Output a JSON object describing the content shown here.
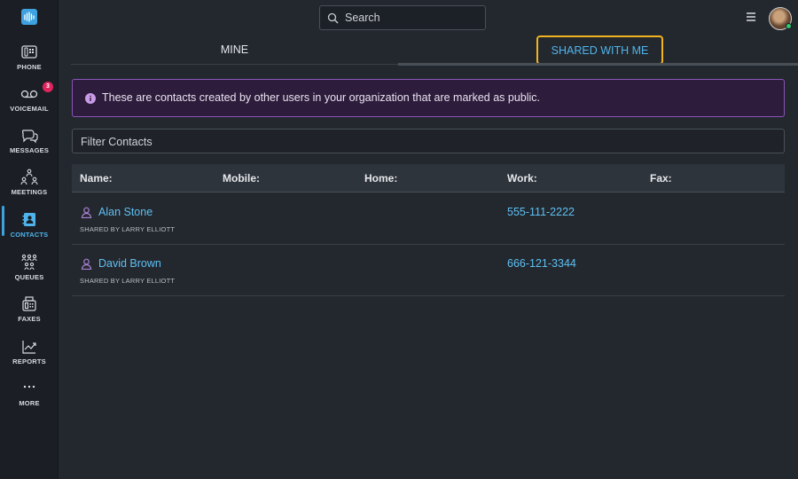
{
  "nav": {
    "items": [
      {
        "label": "PHONE",
        "icon": "phone-icon"
      },
      {
        "label": "VOICEMAIL",
        "icon": "voicemail-icon",
        "badge": "3"
      },
      {
        "label": "MESSAGES",
        "icon": "messages-icon"
      },
      {
        "label": "MEETINGS",
        "icon": "meetings-icon"
      },
      {
        "label": "CONTACTS",
        "icon": "contacts-icon",
        "active": true
      },
      {
        "label": "QUEUES",
        "icon": "queues-icon"
      },
      {
        "label": "FAXES",
        "icon": "fax-icon"
      },
      {
        "label": "REPORTS",
        "icon": "reports-icon"
      },
      {
        "label": "MORE",
        "icon": "more-icon"
      }
    ]
  },
  "search": {
    "placeholder": "Search"
  },
  "tabs": {
    "mine": "MINE",
    "shared": "SHARED WITH ME"
  },
  "banner": {
    "text": "These are contacts created by other users in your organization that are marked as public."
  },
  "filter": {
    "placeholder": "Filter Contacts"
  },
  "table": {
    "headers": {
      "name": "Name:",
      "mobile": "Mobile:",
      "home": "Home:",
      "work": "Work:",
      "fax": "Fax:"
    },
    "rows": [
      {
        "name": "Alan Stone",
        "shared_by": "SHARED BY LARRY ELLIOTT",
        "mobile": "",
        "home": "",
        "work": "555-111-2222",
        "fax": ""
      },
      {
        "name": "David Brown",
        "shared_by": "SHARED BY LARRY ELLIOTT",
        "mobile": "",
        "home": "",
        "work": "666-121-3344",
        "fax": ""
      }
    ]
  },
  "colors": {
    "accent": "#3ea2e0",
    "highlight": "#f2b320",
    "banner_border": "#8a54b8"
  }
}
